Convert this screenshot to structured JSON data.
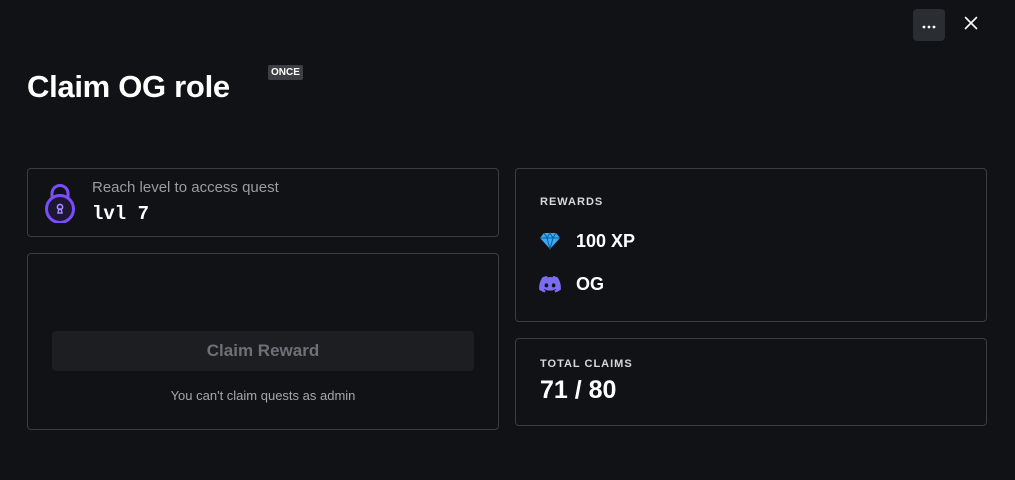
{
  "header": {
    "more_icon": "more-horizontal-icon",
    "close_icon": "close-icon",
    "title": "Claim OG role",
    "badge": "ONCE"
  },
  "requirement": {
    "icon": "lock-icon",
    "hint": "Reach level to access quest",
    "level": "lvl 7",
    "accent_color": "#7c4dff"
  },
  "claim": {
    "button_label": "Claim Reward",
    "note": "You can't claim quests as admin"
  },
  "rewards": {
    "label": "REWARDS",
    "items": [
      {
        "icon": "diamond-icon",
        "text": "100 XP",
        "color": "#3ba9f5"
      },
      {
        "icon": "discord-icon",
        "text": "OG",
        "color": "#7b6cf0"
      }
    ]
  },
  "claims": {
    "label": "TOTAL CLAIMS",
    "value": "71 / 80"
  }
}
